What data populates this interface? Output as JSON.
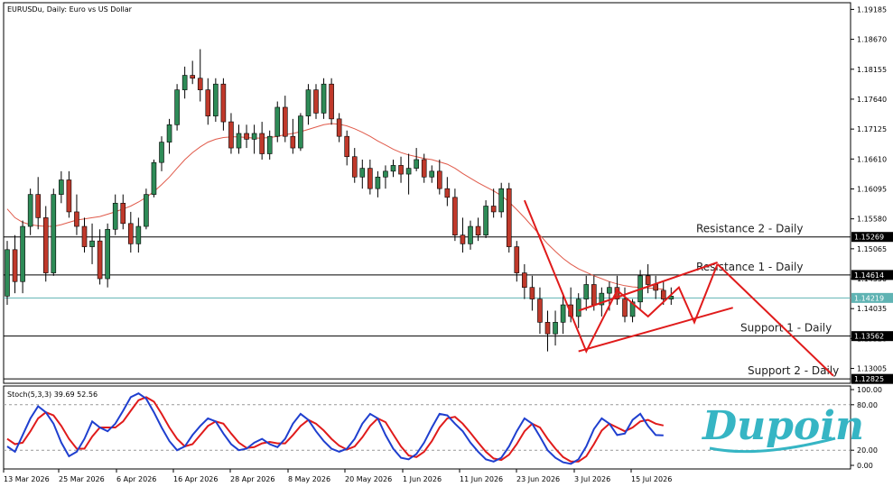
{
  "header": "EURUSDu, Daily:  Euro vs US Dollar",
  "osc_header": "Stoch(5,3,3) 39.69 52.56",
  "brand": "Dupoin",
  "price_ticks": [
    "1.19185",
    "1.18670",
    "1.18155",
    "1.17640",
    "1.17125",
    "1.16610",
    "1.16095",
    "1.15580",
    "1.15065",
    "1.14550",
    "1.14035",
    "1.13520",
    "1.13005"
  ],
  "osc_ticks": [
    "100.00",
    "80.00",
    "20.00",
    "0.00"
  ],
  "level_tags": {
    "r2": "1.15269",
    "r1": "1.14614",
    "last": "1.14219",
    "s1": "1.13562",
    "s2": "1.12825"
  },
  "level_labels": {
    "r2": "Resistance 2 - Daily",
    "r1": "Resistance 1 - Daily",
    "s1": "Support 1 - Daily",
    "s2": "Support 2 - Daily"
  },
  "date_labels": [
    "13 Mar 2026",
    "25 Mar 2026",
    "6 Apr 2026",
    "16 Apr 2026",
    "28 Apr 2026",
    "8 May 2026",
    "20 May 2026",
    "1 Jun 2026",
    "11 Jun 2026",
    "23 Jun 2026",
    "3 Jul 2026",
    "15 Jul 2026"
  ],
  "colors": {
    "bull": "#2e8b57",
    "bear": "#c0392b",
    "ma": "#e05a4a",
    "annotation": "#e01b1b",
    "stoch_main": "#1f3fcf",
    "stoch_signal": "#e01b1b",
    "last_line": "#5fb3b3",
    "brand": "#36b5c4"
  },
  "chart_data": {
    "type": "candlestick",
    "symbol": "EURUSDu",
    "timeframe": "Daily",
    "ylim": [
      1.1275,
      1.193
    ],
    "levels": [
      {
        "name": "Resistance 2 - Daily",
        "value": 1.15269
      },
      {
        "name": "Resistance 1 - Daily",
        "value": 1.14614
      },
      {
        "name": "Support 1 - Daily",
        "value": 1.13562
      },
      {
        "name": "Support 2 - Daily",
        "value": 1.12825
      }
    ],
    "last_price": 1.14219,
    "ohlc": [
      [
        1.1425,
        1.152,
        1.141,
        1.1505
      ],
      [
        1.1505,
        1.153,
        1.143,
        1.145
      ],
      [
        1.145,
        1.1555,
        1.143,
        1.1545
      ],
      [
        1.1545,
        1.161,
        1.153,
        1.16
      ],
      [
        1.16,
        1.163,
        1.154,
        1.156
      ],
      [
        1.156,
        1.158,
        1.145,
        1.1465
      ],
      [
        1.1465,
        1.161,
        1.146,
        1.16
      ],
      [
        1.16,
        1.164,
        1.1585,
        1.1625
      ],
      [
        1.1625,
        1.164,
        1.156,
        1.157
      ],
      [
        1.157,
        1.16,
        1.153,
        1.1545
      ],
      [
        1.1545,
        1.156,
        1.15,
        1.151
      ],
      [
        1.151,
        1.155,
        1.148,
        1.152
      ],
      [
        1.152,
        1.154,
        1.1445,
        1.1455
      ],
      [
        1.1455,
        1.155,
        1.144,
        1.154
      ],
      [
        1.154,
        1.16,
        1.153,
        1.1585
      ],
      [
        1.1585,
        1.16,
        1.154,
        1.155
      ],
      [
        1.155,
        1.157,
        1.15,
        1.1515
      ],
      [
        1.1515,
        1.156,
        1.15,
        1.1545
      ],
      [
        1.1545,
        1.161,
        1.154,
        1.16
      ],
      [
        1.16,
        1.166,
        1.1595,
        1.1655
      ],
      [
        1.1655,
        1.17,
        1.164,
        1.169
      ],
      [
        1.169,
        1.173,
        1.167,
        1.172
      ],
      [
        1.172,
        1.179,
        1.171,
        1.178
      ],
      [
        1.178,
        1.182,
        1.1765,
        1.1805
      ],
      [
        1.1805,
        1.183,
        1.179,
        1.18
      ],
      [
        1.18,
        1.185,
        1.176,
        1.178
      ],
      [
        1.178,
        1.18,
        1.172,
        1.1735
      ],
      [
        1.1735,
        1.18,
        1.1725,
        1.179
      ],
      [
        1.179,
        1.18,
        1.171,
        1.1725
      ],
      [
        1.1725,
        1.174,
        1.167,
        1.168
      ],
      [
        1.168,
        1.172,
        1.167,
        1.1705
      ],
      [
        1.1705,
        1.172,
        1.168,
        1.1695
      ],
      [
        1.1695,
        1.172,
        1.167,
        1.1705
      ],
      [
        1.1705,
        1.1725,
        1.166,
        1.167
      ],
      [
        1.167,
        1.171,
        1.166,
        1.17
      ],
      [
        1.17,
        1.176,
        1.169,
        1.175
      ],
      [
        1.175,
        1.177,
        1.169,
        1.17
      ],
      [
        1.17,
        1.173,
        1.167,
        1.168
      ],
      [
        1.168,
        1.174,
        1.1675,
        1.1735
      ],
      [
        1.1735,
        1.179,
        1.172,
        1.178
      ],
      [
        1.178,
        1.179,
        1.173,
        1.174
      ],
      [
        1.174,
        1.18,
        1.173,
        1.179
      ],
      [
        1.179,
        1.18,
        1.172,
        1.173
      ],
      [
        1.173,
        1.174,
        1.169,
        1.17
      ],
      [
        1.17,
        1.171,
        1.165,
        1.1665
      ],
      [
        1.1665,
        1.168,
        1.162,
        1.163
      ],
      [
        1.163,
        1.166,
        1.161,
        1.1645
      ],
      [
        1.1645,
        1.166,
        1.16,
        1.161
      ],
      [
        1.161,
        1.164,
        1.1595,
        1.163
      ],
      [
        1.163,
        1.165,
        1.161,
        1.164
      ],
      [
        1.164,
        1.166,
        1.163,
        1.165
      ],
      [
        1.165,
        1.1665,
        1.162,
        1.1635
      ],
      [
        1.1635,
        1.167,
        1.16,
        1.1645
      ],
      [
        1.1645,
        1.168,
        1.164,
        1.166
      ],
      [
        1.166,
        1.167,
        1.162,
        1.163
      ],
      [
        1.163,
        1.165,
        1.162,
        1.164
      ],
      [
        1.164,
        1.166,
        1.16,
        1.161
      ],
      [
        1.161,
        1.163,
        1.158,
        1.1595
      ],
      [
        1.1595,
        1.161,
        1.152,
        1.153
      ],
      [
        1.153,
        1.156,
        1.15,
        1.1515
      ],
      [
        1.1515,
        1.1555,
        1.1505,
        1.1545
      ],
      [
        1.1545,
        1.156,
        1.152,
        1.153
      ],
      [
        1.153,
        1.159,
        1.1525,
        1.158
      ],
      [
        1.158,
        1.161,
        1.156,
        1.157
      ],
      [
        1.157,
        1.162,
        1.156,
        1.161
      ],
      [
        1.161,
        1.162,
        1.15,
        1.151
      ],
      [
        1.151,
        1.152,
        1.145,
        1.1465
      ],
      [
        1.1465,
        1.148,
        1.142,
        1.144
      ],
      [
        1.144,
        1.146,
        1.14,
        1.142
      ],
      [
        1.142,
        1.144,
        1.136,
        1.138
      ],
      [
        1.138,
        1.14,
        1.133,
        1.136
      ],
      [
        1.136,
        1.14,
        1.134,
        1.138
      ],
      [
        1.138,
        1.143,
        1.136,
        1.141
      ],
      [
        1.141,
        1.144,
        1.138,
        1.139
      ],
      [
        1.139,
        1.143,
        1.137,
        1.142
      ],
      [
        1.142,
        1.146,
        1.14,
        1.1445
      ],
      [
        1.1445,
        1.146,
        1.14,
        1.141
      ],
      [
        1.141,
        1.144,
        1.139,
        1.143
      ],
      [
        1.143,
        1.145,
        1.14,
        1.144
      ],
      [
        1.144,
        1.146,
        1.141,
        1.142
      ],
      [
        1.142,
        1.144,
        1.138,
        1.139
      ],
      [
        1.139,
        1.142,
        1.138,
        1.1415
      ],
      [
        1.1415,
        1.147,
        1.14,
        1.146
      ],
      [
        1.146,
        1.148,
        1.143,
        1.1445
      ],
      [
        1.1445,
        1.146,
        1.142,
        1.1435
      ],
      [
        1.1435,
        1.145,
        1.141,
        1.142
      ],
      [
        1.142,
        1.144,
        1.141,
        1.1425
      ]
    ],
    "ma_series": [
      1.1575,
      1.156,
      1.1552,
      1.1548,
      1.1546,
      1.1545,
      1.1545,
      1.1548,
      1.1552,
      1.1556,
      1.1558,
      1.156,
      1.1562,
      1.1566,
      1.157,
      1.1575,
      1.158,
      1.1587,
      1.1595,
      1.1605,
      1.1617,
      1.163,
      1.1645,
      1.166,
      1.1672,
      1.1682,
      1.169,
      1.1695,
      1.1698,
      1.1699,
      1.1699,
      1.1698,
      1.1697,
      1.1697,
      1.1698,
      1.17,
      1.1703,
      1.1705,
      1.1708,
      1.1712,
      1.1716,
      1.172,
      1.1722,
      1.1721,
      1.1718,
      1.1713,
      1.1707,
      1.17,
      1.1692,
      1.1685,
      1.1678,
      1.1672,
      1.1668,
      1.1665,
      1.1662,
      1.166,
      1.1656,
      1.1652,
      1.1645,
      1.1636,
      1.1628,
      1.162,
      1.1613,
      1.1606,
      1.1598,
      1.1587,
      1.1574,
      1.156,
      1.1545,
      1.153,
      1.1515,
      1.1502,
      1.149,
      1.148,
      1.1472,
      1.1466,
      1.146,
      1.1455,
      1.145,
      1.1446,
      1.1443,
      1.1441,
      1.144,
      1.1439,
      1.1438,
      1.1437
    ],
    "annotations": {
      "channel_upper": [
        [
          "2026-06-23",
          1.14
        ],
        [
          "2026-07-17",
          1.1483
        ]
      ],
      "channel_lower": [
        [
          "2026-06-23",
          1.133
        ],
        [
          "2026-07-21",
          1.1405
        ]
      ],
      "zigzag": [
        [
          "2026-06-12",
          1.159
        ],
        [
          "2026-06-24",
          1.133
        ],
        [
          "2026-06-30",
          1.1435
        ],
        [
          "2026-07-06",
          1.139
        ],
        [
          "2026-07-10",
          1.144
        ],
        [
          "2026-07-14",
          1.138
        ],
        [
          "2026-07-17",
          1.148
        ]
      ],
      "projection": [
        [
          "2026-07-17",
          1.148
        ],
        [
          "2026-08-08",
          1.1288
        ]
      ]
    },
    "stochastic": {
      "name": "Stoch(5,3,3)",
      "main_last": 39.69,
      "signal_last": 52.56,
      "ylim": [
        0,
        100
      ],
      "levels": [
        20,
        80
      ],
      "main": [
        25,
        18,
        40,
        62,
        78,
        70,
        55,
        30,
        12,
        18,
        35,
        58,
        50,
        45,
        55,
        72,
        90,
        95,
        88,
        70,
        50,
        32,
        20,
        25,
        40,
        52,
        62,
        58,
        42,
        28,
        20,
        22,
        30,
        35,
        28,
        24,
        35,
        55,
        68,
        60,
        45,
        32,
        22,
        18,
        22,
        35,
        55,
        68,
        62,
        40,
        22,
        10,
        8,
        15,
        30,
        50,
        68,
        66,
        55,
        45,
        30,
        18,
        8,
        5,
        10,
        25,
        45,
        62,
        55,
        38,
        20,
        10,
        4,
        2,
        8,
        25,
        48,
        62,
        55,
        40,
        42,
        60,
        68,
        52,
        40,
        39.69
      ],
      "signal": [
        35,
        28,
        30,
        45,
        62,
        70,
        66,
        52,
        35,
        22,
        22,
        38,
        50,
        50,
        50,
        58,
        72,
        86,
        90,
        84,
        68,
        50,
        35,
        25,
        28,
        40,
        52,
        58,
        55,
        42,
        30,
        23,
        24,
        29,
        31,
        29,
        29,
        40,
        52,
        60,
        55,
        46,
        35,
        26,
        21,
        25,
        37,
        52,
        62,
        57,
        41,
        25,
        13,
        11,
        18,
        32,
        50,
        62,
        64,
        55,
        43,
        30,
        18,
        9,
        7,
        14,
        28,
        45,
        55,
        50,
        35,
        22,
        11,
        5,
        5,
        12,
        28,
        46,
        55,
        50,
        45,
        50,
        58,
        60,
        55,
        52.56
      ]
    }
  }
}
